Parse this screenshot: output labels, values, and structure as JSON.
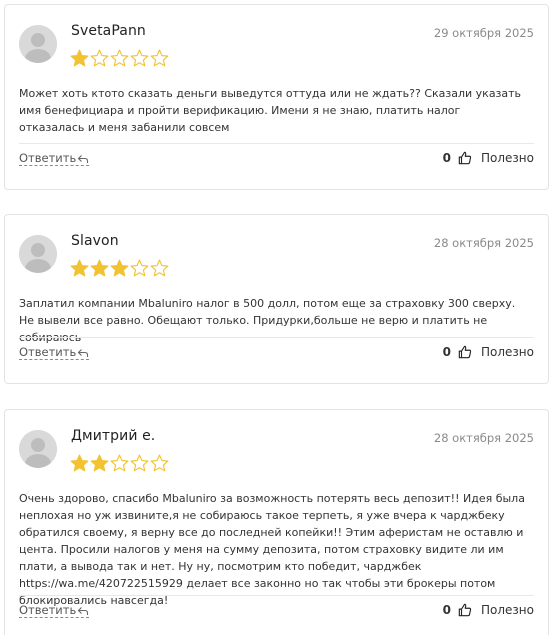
{
  "colors": {
    "star_filled": "#f2c230",
    "star_empty_stroke": "#f2c230",
    "text": "#333333",
    "date": "#8a8a8a",
    "border": "#e3e3e3"
  },
  "reviews": [
    {
      "author": "SvetaPann",
      "date": "29 октября 2025",
      "rating": 1,
      "rating_max": 5,
      "text": "Может хоть ктото сказать деньги выведутся оттуда или не ждать?? Сказали указать имя бенефициара и пройти верификацию. Имени я не знаю, платить налог отказалась и меня забанили совсем",
      "reply_label": "Ответить",
      "likes": "0",
      "useful_label": "Полезно"
    },
    {
      "author": "Slavon",
      "date": "28 октября 2025",
      "rating": 3,
      "rating_max": 5,
      "text": "Заплатил компании Mbaluniro налог в 500 долл, потом еще за страховку 300 сверху. Не вывели все равно. Обещают только. Придурки,больше не верю и платить не собираюсь",
      "reply_label": "Ответить",
      "likes": "0",
      "useful_label": "Полезно"
    },
    {
      "author": "Дмитрий е.",
      "date": "28 октября 2025",
      "rating": 2,
      "rating_max": 5,
      "text_before_link": "Очень здорово, спасибо Mbaluniro за возможность потерять весь депозит!! Идея была неплохая но уж извините,я не собираюсь такое терпеть, я уже вчера к чарджбеку обратился своему, я верну все до последней копейки!! Этим аферистам не оставлю и цента. Просили налогов у меня на сумму депозита, потом страховку видите ли им плати, а вывода так и нет. Ну ну, посмотрим кто победит, чарджбек ",
      "link_text": "https://wa.me/420722515929",
      "text_after_link": " делает все законно но так чтобы эти брокеры потом блокировались навсегда!",
      "reply_label": "Ответить",
      "likes": "0",
      "useful_label": "Полезно"
    }
  ]
}
